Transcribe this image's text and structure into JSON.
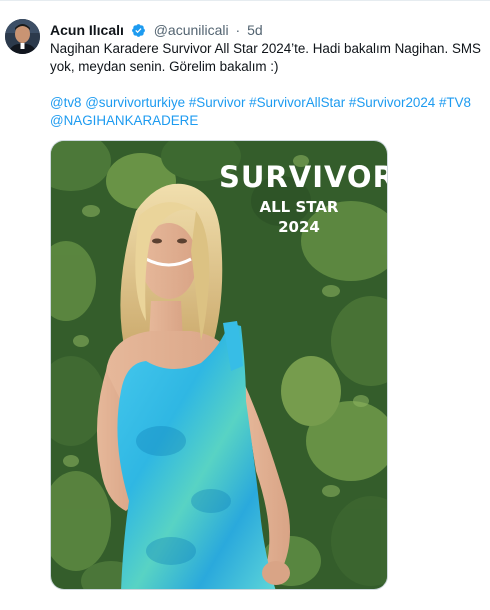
{
  "author": {
    "display_name": "Acun Ilıcalı",
    "handle": "@acunilicali",
    "separator": "·",
    "time": "5d",
    "verified": true
  },
  "tweet": {
    "text_lines": [
      "Nagihan Karadere Survivor All Star 2024’te. Hadi bakalım Nagihan. SMS",
      "yok, meydan senin. Görelim bakalım :)"
    ],
    "tags": [
      "@tv8",
      "@survivorturkiye",
      "#Survivor",
      "#SurvivorAllStar",
      "#Survivor2024",
      "#TV8",
      "@NAGIHANKARADERE"
    ]
  },
  "media": {
    "logo_title": "SURVIVOR",
    "logo_line1": "ALL STAR",
    "logo_line2": "2024"
  },
  "colors": {
    "link": "#1d9bf0",
    "text": "#0f1419",
    "secondary": "#536471",
    "dress": "#3fc3e8",
    "foliage": "#2f5a26"
  }
}
